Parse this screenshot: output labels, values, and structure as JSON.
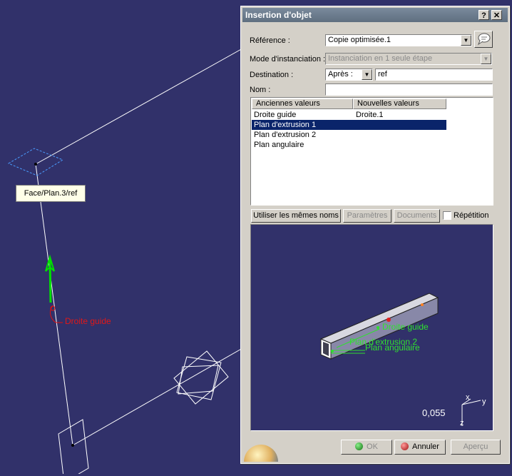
{
  "viewport": {
    "tooltip": "Face/Plan.3/ref",
    "label_droite_guide": "Droite guide"
  },
  "dialog": {
    "title": "Insertion d'objet",
    "help_btn": "?",
    "close_btn": "✕",
    "reference": {
      "label": "Référence :",
      "value": "Copie optimisée.1"
    },
    "mode": {
      "label": "Mode d'instanciation :",
      "value": "Instanciation en 1 seule étape"
    },
    "destination": {
      "label": "Destination :",
      "select": "Après :",
      "value": "ref"
    },
    "nom": {
      "label": "Nom :",
      "value": ""
    },
    "table": {
      "headers": [
        "Anciennes valeurs",
        "Nouvelles valeurs"
      ],
      "rows": [
        {
          "old": "Droite guide",
          "new": "Droite.1"
        },
        {
          "old": "Plan d'extrusion 1",
          "new": ""
        },
        {
          "old": "Plan d'extrusion 2",
          "new": ""
        },
        {
          "old": "Plan angulaire",
          "new": ""
        }
      ],
      "selected_index": 1
    },
    "buttons": {
      "same_names": "Utiliser les mêmes noms",
      "params": "Paramètres",
      "documents": "Documents",
      "repetition": "Répétition"
    },
    "preview": {
      "label_droite_guide": "Droite guide",
      "label_plan_extrusion_2": "Plan d'extrusion 2",
      "label_plan_angulaire": "Plan angulaire",
      "scale": "0,055",
      "axis_x": "x",
      "axis_y": "y",
      "axis_z": "z"
    },
    "footer": {
      "ok": "OK",
      "cancel": "Annuler",
      "preview": "Aperçu"
    }
  }
}
